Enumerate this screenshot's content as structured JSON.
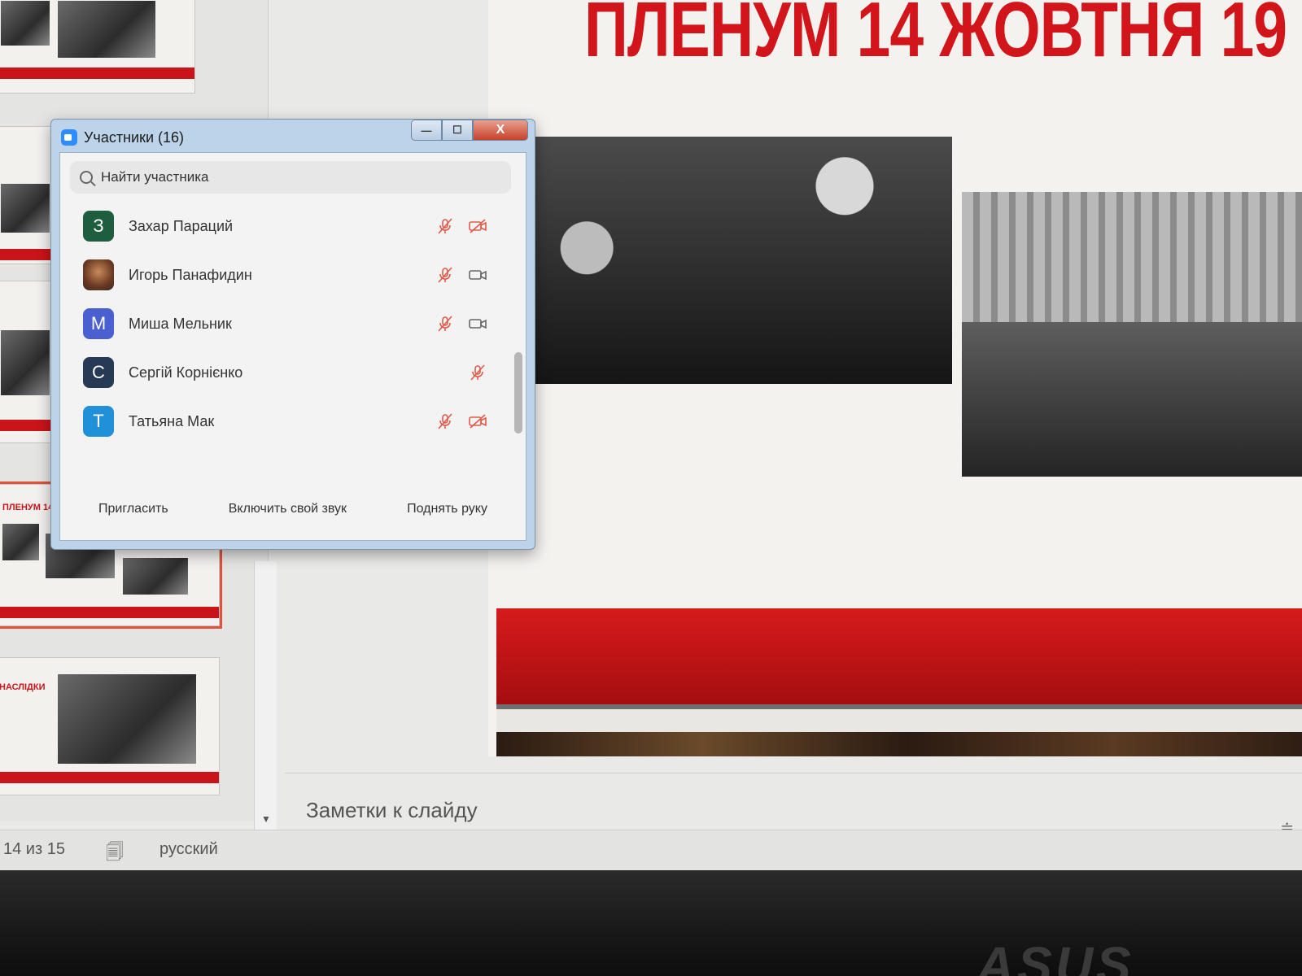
{
  "slide": {
    "title": "ПЛЕНУМ 14 ЖОВТНЯ 19"
  },
  "thumbnails": {
    "title_a": "ПЛЕНУМ 14 ЖОВ",
    "title_b": "НАСЛІДКИ"
  },
  "notes": {
    "label": "Заметки к слайду"
  },
  "status": {
    "slide_counter": "14 из 15",
    "language": "русский"
  },
  "participants_window": {
    "title": "Участники (16)",
    "minimize_label": "—",
    "maximize_label": "☐",
    "close_label": "X",
    "search_placeholder": "Найти участника",
    "participants": [
      {
        "initial": "З",
        "name": "Захар Параций",
        "avatar_color": "#1e5e3e",
        "mic_muted": true,
        "camera_off": true
      },
      {
        "initial": "",
        "name": "Игорь Панафидин",
        "avatar_color": "",
        "mic_muted": true,
        "camera_off": false
      },
      {
        "initial": "М",
        "name": "Миша Мельник",
        "avatar_color": "#4a5fd0",
        "mic_muted": true,
        "camera_off": false
      },
      {
        "initial": "С",
        "name": "Сергій Корнієнко",
        "avatar_color": "#263a55",
        "mic_muted": true,
        "camera_off": null
      },
      {
        "initial": "Т",
        "name": "Татьяна Мак",
        "avatar_color": "#2090d8",
        "mic_muted": true,
        "camera_off": true
      }
    ],
    "footer": {
      "invite": "Пригласить",
      "unmute": "Включить свой звук",
      "raise_hand": "Поднять руку"
    }
  },
  "device": {
    "brand": "ASUS"
  },
  "colors": {
    "accent_red": "#d2141b",
    "muted_red": "#e05a4a",
    "zoom_blue": "#2d8cff"
  }
}
